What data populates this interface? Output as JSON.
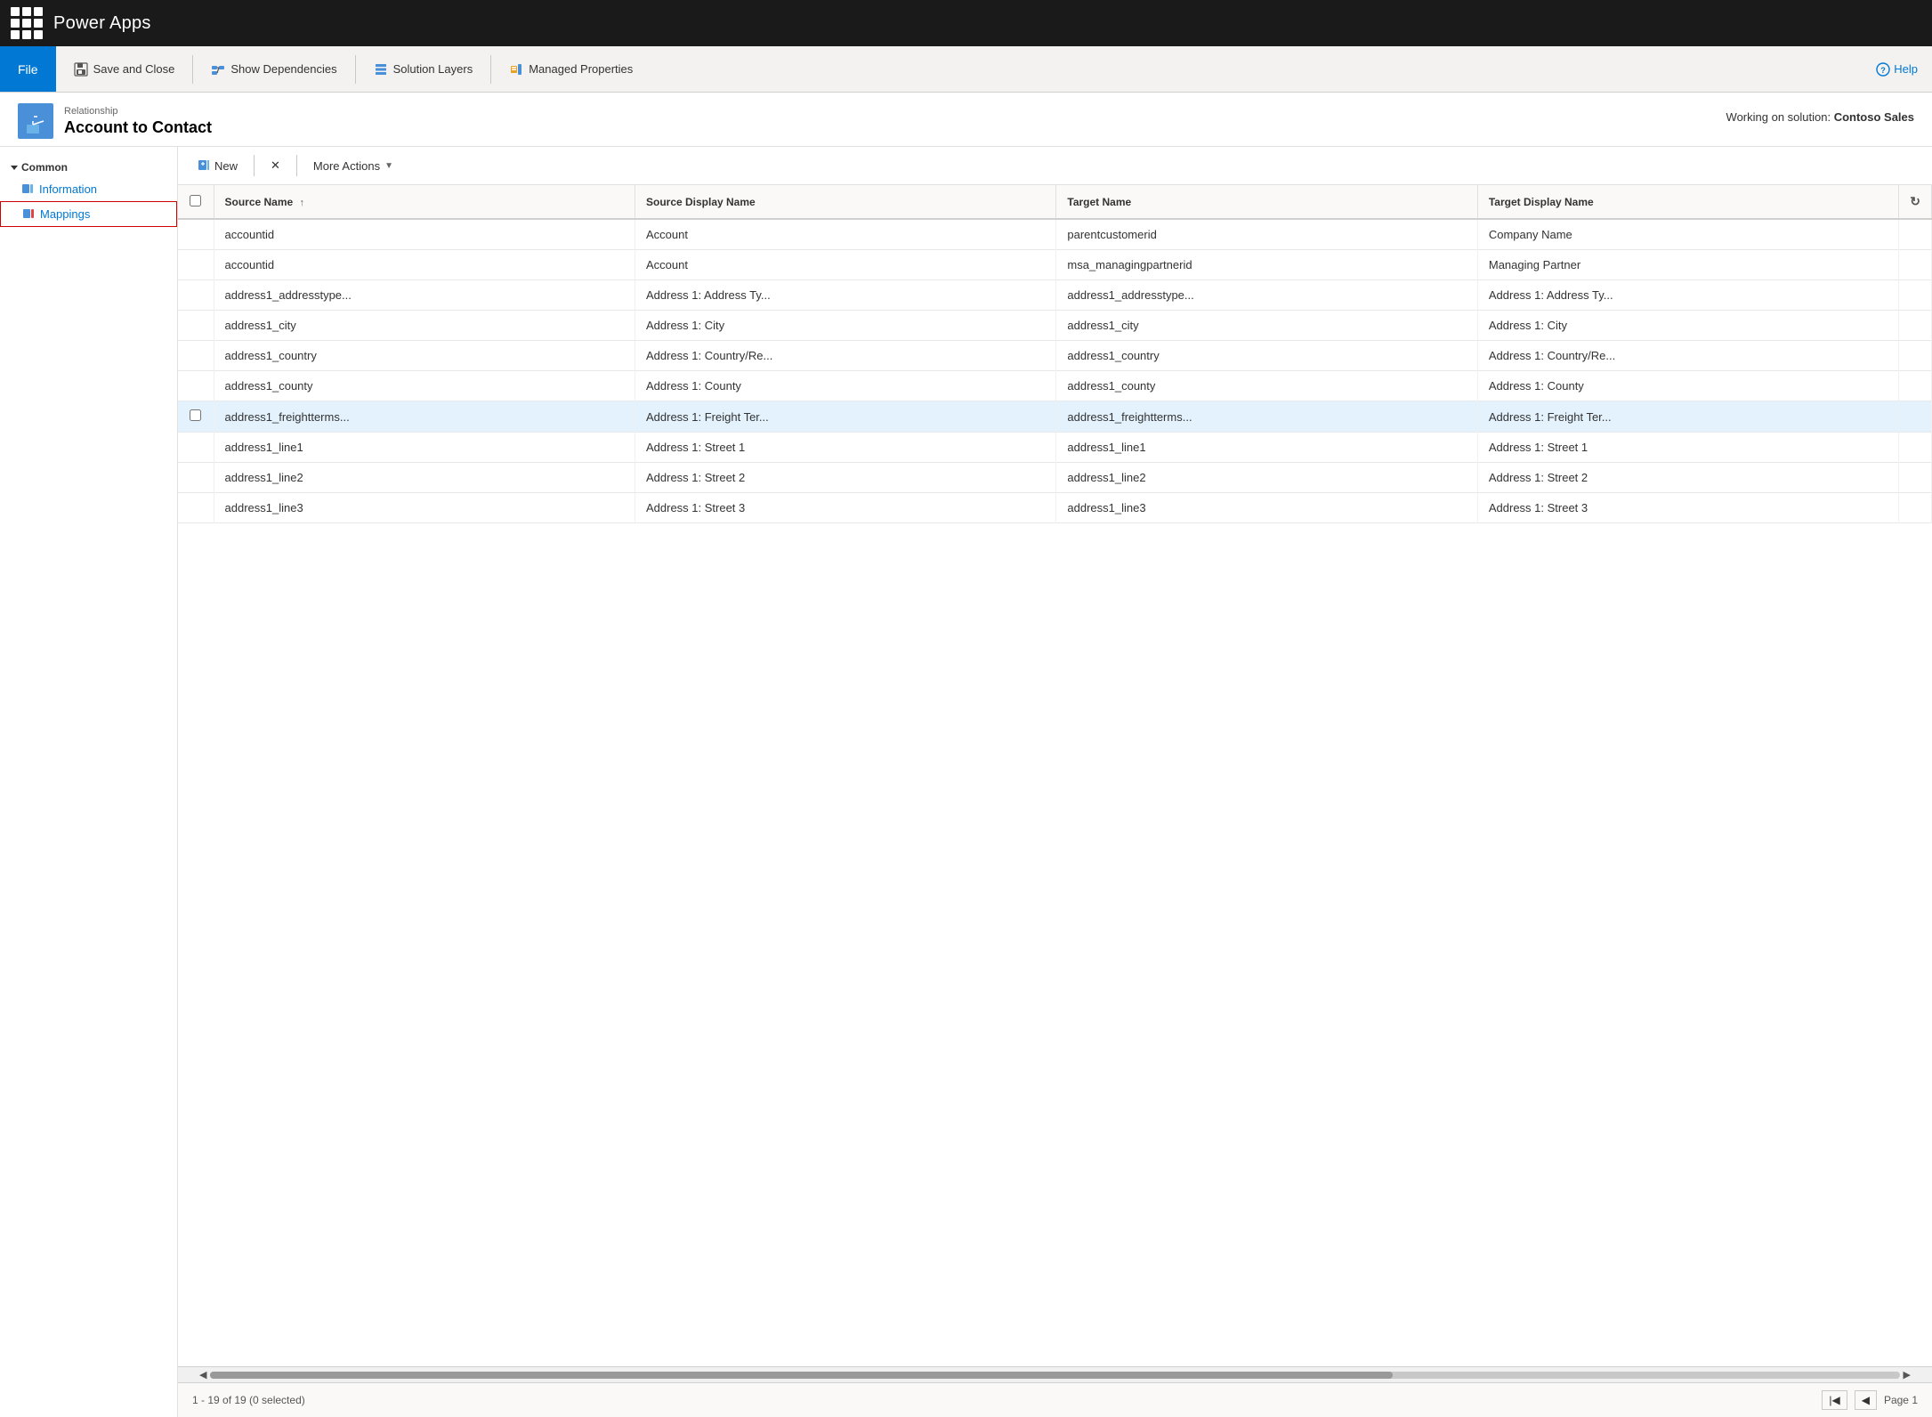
{
  "app": {
    "title": "Power Apps"
  },
  "ribbon": {
    "file_label": "File",
    "save_close_label": "Save and Close",
    "show_dependencies_label": "Show Dependencies",
    "solution_layers_label": "Solution Layers",
    "managed_properties_label": "Managed Properties",
    "help_label": "Help"
  },
  "page": {
    "subtitle": "Relationship",
    "title": "Account to Contact",
    "working_on_label": "Working on solution:",
    "working_on_value": "Contoso Sales"
  },
  "sidebar": {
    "section_label": "Common",
    "items": [
      {
        "label": "Information",
        "active": false
      },
      {
        "label": "Mappings",
        "active": true
      }
    ]
  },
  "toolbar": {
    "new_label": "New",
    "delete_label": "✕",
    "more_actions_label": "More Actions"
  },
  "table": {
    "columns": [
      {
        "key": "checkbox",
        "label": ""
      },
      {
        "key": "source_name",
        "label": "Source Name",
        "sortable": true
      },
      {
        "key": "source_display_name",
        "label": "Source Display Name"
      },
      {
        "key": "target_name",
        "label": "Target Name"
      },
      {
        "key": "target_display_name",
        "label": "Target Display Name"
      }
    ],
    "rows": [
      {
        "id": 1,
        "source_name": "accountid",
        "source_display_name": "Account",
        "target_name": "parentcustomerid",
        "target_display_name": "Company Name",
        "highlighted": false
      },
      {
        "id": 2,
        "source_name": "accountid",
        "source_display_name": "Account",
        "target_name": "msa_managingpartnerid",
        "target_display_name": "Managing Partner",
        "highlighted": false
      },
      {
        "id": 3,
        "source_name": "address1_addresstype...",
        "source_display_name": "Address 1: Address Ty...",
        "target_name": "address1_addresstype...",
        "target_display_name": "Address 1: Address Ty...",
        "highlighted": false
      },
      {
        "id": 4,
        "source_name": "address1_city",
        "source_display_name": "Address 1: City",
        "target_name": "address1_city",
        "target_display_name": "Address 1: City",
        "highlighted": false
      },
      {
        "id": 5,
        "source_name": "address1_country",
        "source_display_name": "Address 1: Country/Re...",
        "target_name": "address1_country",
        "target_display_name": "Address 1: Country/Re...",
        "highlighted": false
      },
      {
        "id": 6,
        "source_name": "address1_county",
        "source_display_name": "Address 1: County",
        "target_name": "address1_county",
        "target_display_name": "Address 1: County",
        "highlighted": false
      },
      {
        "id": 7,
        "source_name": "address1_freightterms...",
        "source_display_name": "Address 1: Freight Ter...",
        "target_name": "address1_freightterms...",
        "target_display_name": "Address 1: Freight Ter...",
        "highlighted": true
      },
      {
        "id": 8,
        "source_name": "address1_line1",
        "source_display_name": "Address 1: Street 1",
        "target_name": "address1_line1",
        "target_display_name": "Address 1: Street 1",
        "highlighted": false
      },
      {
        "id": 9,
        "source_name": "address1_line2",
        "source_display_name": "Address 1: Street 2",
        "target_name": "address1_line2",
        "target_display_name": "Address 1: Street 2",
        "highlighted": false
      },
      {
        "id": 10,
        "source_name": "address1_line3",
        "source_display_name": "Address 1: Street 3",
        "target_name": "address1_line3",
        "target_display_name": "Address 1: Street 3",
        "highlighted": false
      }
    ]
  },
  "footer": {
    "record_count": "1 - 19 of 19 (0 selected)",
    "page_label": "Page 1"
  }
}
